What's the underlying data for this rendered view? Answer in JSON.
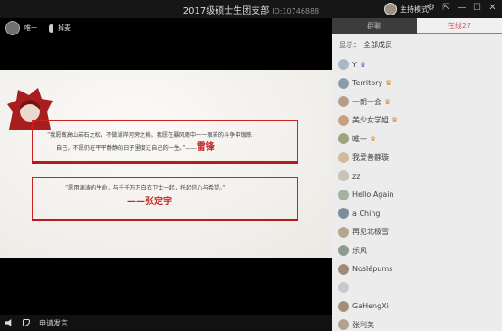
{
  "window": {
    "title": "2017级硕士生团支部",
    "room_id": "ID:10746888",
    "host_mode_label": "主持模式"
  },
  "stage": {
    "speaker_name": "唯一",
    "mic_label": "掉麦",
    "slide": {
      "quote1_line1": "“我愿做高山岩石之松，不做湖岸河旁之柳。我愿在暴风雨中一一艰苦的斗争中锻炼",
      "quote1_line2": "自己，不愿仍在平平静静的日子里度过自己的一生。”——",
      "quote1_author": "雷锋",
      "quote2_line1": "“愿用澜涛的生命，与千千万万白衣卫士一起，托起信心与希望。”",
      "quote2_author": "——张定宇"
    },
    "bottom": {
      "apply_speak_label": "申请发言"
    }
  },
  "panel": {
    "tabs": [
      {
        "label": "群聊",
        "active": false
      },
      {
        "label": "在线27",
        "active": true
      }
    ],
    "filter_label": "显示：",
    "filter_value": "全部成员",
    "members": [
      {
        "name": "Y",
        "badge": "♛",
        "badge_color": "purple"
      },
      {
        "name": "Territory",
        "badge": "♛",
        "badge_color": "orange"
      },
      {
        "name": "一朗一会",
        "badge": "♛",
        "badge_color": "orange"
      },
      {
        "name": "美少女学姐",
        "badge": "♛",
        "badge_color": "orange"
      },
      {
        "name": "唯一",
        "badge": "♛",
        "badge_color": "orange"
      },
      {
        "name": "我爱善静璇",
        "badge": "",
        "badge_color": ""
      },
      {
        "name": "zz",
        "badge": "",
        "badge_color": ""
      },
      {
        "name": "Hello Again",
        "badge": "",
        "badge_color": ""
      },
      {
        "name": "a Ching",
        "badge": "",
        "badge_color": ""
      },
      {
        "name": "再见北极雪",
        "badge": "",
        "badge_color": ""
      },
      {
        "name": "乐风",
        "badge": "",
        "badge_color": ""
      },
      {
        "name": "Noslépums",
        "badge": "",
        "badge_color": ""
      },
      {
        "name": "",
        "badge": "",
        "badge_color": ""
      },
      {
        "name": "GaHengXi",
        "badge": "",
        "badge_color": ""
      },
      {
        "name": "张利美",
        "badge": "",
        "badge_color": ""
      }
    ]
  },
  "colors": {
    "accent_red": "#c62828",
    "tab_active": "#e05c5c"
  }
}
